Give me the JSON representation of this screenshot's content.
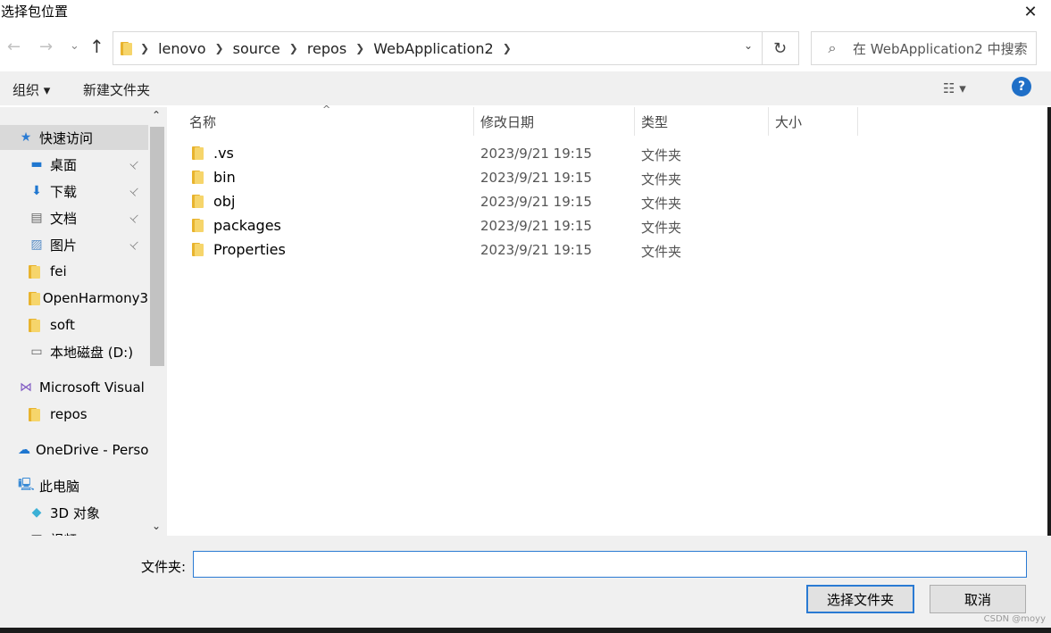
{
  "window": {
    "title": "选择包位置",
    "close_glyph": "✕"
  },
  "nav": {
    "back_glyph": "←",
    "forward_glyph": "→",
    "recent_glyph": "⌄",
    "up_glyph": "↑",
    "breadcrumbs": [
      "lenovo",
      "source",
      "repos",
      "WebApplication2"
    ],
    "refresh_glyph": "↻",
    "search_placeholder": "在 WebApplication2 中搜索"
  },
  "toolbar": {
    "organize": "组织 ▾",
    "new_folder": "新建文件夹",
    "view_glyph": "☷ ▾",
    "help": "?"
  },
  "sidebar": {
    "items": [
      {
        "label": "快速访问",
        "icon": "star-icon",
        "glyph": "★",
        "color": "#2b7cd3",
        "pinned": false,
        "selected": true
      },
      {
        "label": "桌面",
        "icon": "desktop-icon",
        "glyph": "▬",
        "color": "#1f77d0",
        "pinned": true
      },
      {
        "label": "下载",
        "icon": "download-icon",
        "glyph": "⬇",
        "color": "#1f77d0",
        "pinned": true
      },
      {
        "label": "文档",
        "icon": "document-icon",
        "glyph": "▤",
        "color": "#666",
        "pinned": true
      },
      {
        "label": "图片",
        "icon": "pictures-icon",
        "glyph": "▨",
        "color": "#5b8fc7",
        "pinned": true
      },
      {
        "label": "fei",
        "icon": "folder-icon",
        "pinned": false
      },
      {
        "label": "OpenHarmony3",
        "icon": "folder-icon",
        "pinned": false
      },
      {
        "label": "soft",
        "icon": "folder-icon",
        "pinned": false
      },
      {
        "label": "本地磁盘 (D:)",
        "icon": "drive-icon",
        "glyph": "▭",
        "color": "#666",
        "pinned": false
      },
      {
        "label": "Microsoft Visual",
        "icon": "visual-studio-icon",
        "glyph": "⋈",
        "color": "#7e57c2",
        "pinned": false,
        "top_level": true
      },
      {
        "label": "repos",
        "icon": "folder-icon",
        "pinned": false
      },
      {
        "label": "OneDrive - Perso",
        "icon": "onedrive-icon",
        "glyph": "☁",
        "color": "#1f77d0",
        "pinned": false,
        "top_level": true
      },
      {
        "label": "此电脑",
        "icon": "computer-icon",
        "glyph": "🖳",
        "color": "#3a8bd6",
        "pinned": false,
        "top_level": true
      },
      {
        "label": "3D 对象",
        "icon": "3d-objects-icon",
        "glyph": "◆",
        "color": "#3bb0d6",
        "pinned": false
      },
      {
        "label": "视频",
        "icon": "videos-icon",
        "glyph": "▦",
        "color": "#555",
        "pinned": false
      }
    ],
    "pin_glyph": "📌",
    "scroll_up_glyph": "⌃",
    "scroll_down_glyph": "⌄"
  },
  "columns": {
    "name": "名称",
    "date": "修改日期",
    "type": "类型",
    "size": "大小"
  },
  "files": [
    {
      "name": ".vs",
      "date": "2023/9/21 19:15",
      "type": "文件夹"
    },
    {
      "name": "bin",
      "date": "2023/9/21 19:15",
      "type": "文件夹"
    },
    {
      "name": "obj",
      "date": "2023/9/21 19:15",
      "type": "文件夹"
    },
    {
      "name": "packages",
      "date": "2023/9/21 19:15",
      "type": "文件夹"
    },
    {
      "name": "Properties",
      "date": "2023/9/21 19:15",
      "type": "文件夹"
    }
  ],
  "footer": {
    "folder_label": "文件夹:",
    "folder_value": "",
    "select_button": "选择文件夹",
    "cancel_button": "取消",
    "watermark": "CSDN @moyy"
  }
}
